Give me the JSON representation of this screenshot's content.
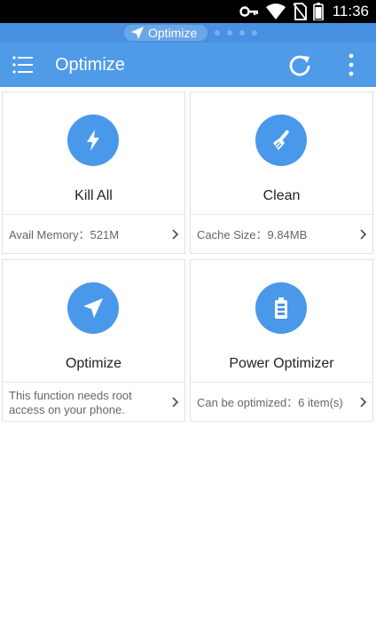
{
  "status_bar": {
    "time": "11:36",
    "icons": [
      "key-icon",
      "wifi-icon",
      "no-sim-icon",
      "battery-icon"
    ]
  },
  "pager": {
    "active_label": "Optimize",
    "icon": "send-icon",
    "dot_count": 4
  },
  "app_bar": {
    "title": "Optimize",
    "menu_icon": "list-menu-icon",
    "refresh_icon": "refresh-icon",
    "more_icon": "more-vert-icon"
  },
  "colors": {
    "accent": "#4f9be8",
    "badge": "#4a98ea",
    "status_bar": "#000000"
  },
  "cards": [
    {
      "title": "Kill All",
      "info": "Avail Memory：521M",
      "icon": "lightning-icon"
    },
    {
      "title": "Clean",
      "info": "Cache Size：9.84MB",
      "icon": "broom-icon"
    },
    {
      "title": "Optimize",
      "info": "This function needs root access on your phone.",
      "icon": "send-icon"
    },
    {
      "title": "Power Optimizer",
      "info": "Can be optimized：6 item(s)",
      "icon": "battery-icon"
    }
  ]
}
